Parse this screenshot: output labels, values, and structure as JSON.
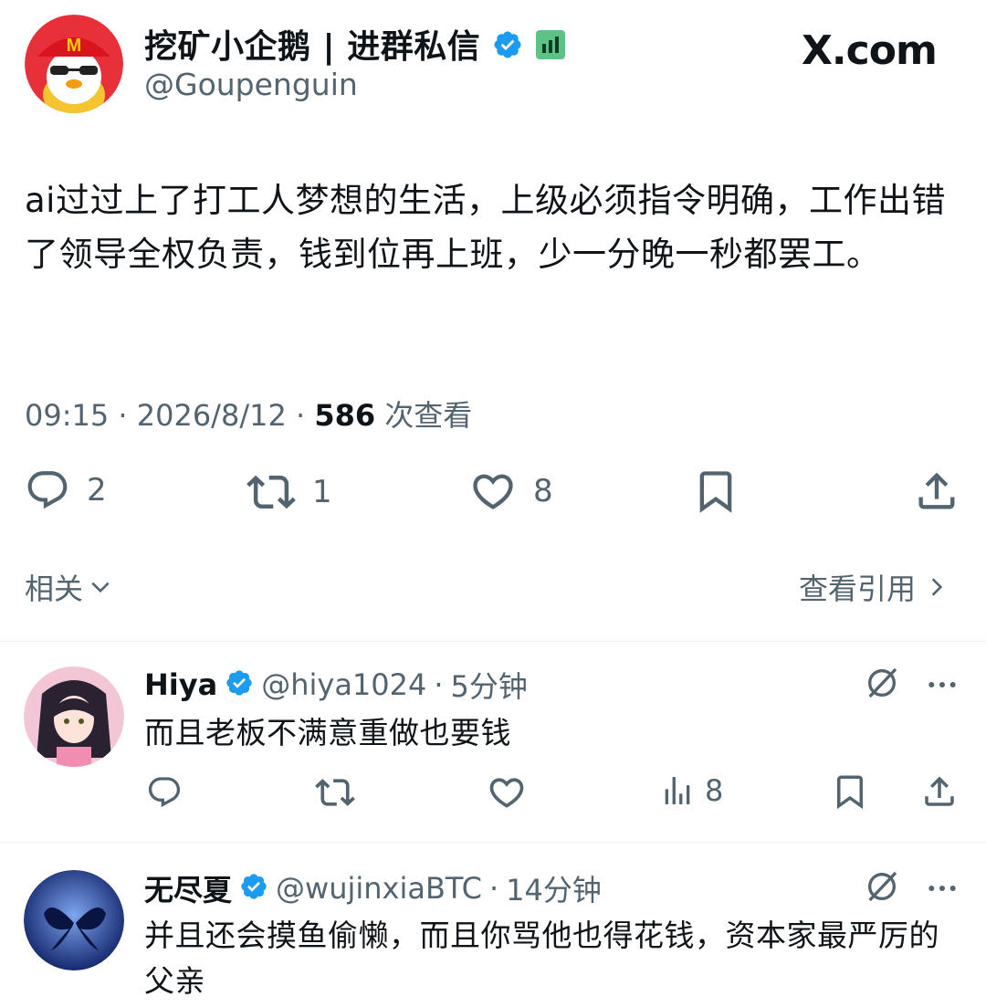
{
  "source": {
    "site": "X.com"
  },
  "tweet": {
    "display_name": "挖矿小企鹅 | 进群私信",
    "handle": "@Goupenguin",
    "text": "ai过过上了打工人梦想的生活，上级必须指令明确，工作出错了领导全权负责，钱到位再上班，少一分晚一秒都罢工。",
    "time": "09:15",
    "date": "2026/8/12",
    "views": "586",
    "views_label": "次查看",
    "replies": "2",
    "retweets": "1",
    "likes": "8"
  },
  "nav": {
    "related_label": "相关",
    "quotes_label": "查看引用"
  },
  "replies": [
    {
      "name": "Hiya",
      "handle": "@hiya1024",
      "time": "5分钟",
      "text": "而且老板不满意重做也要钱",
      "views": "8"
    },
    {
      "name": "无尽夏",
      "handle": "@wujinxiaBTC",
      "time": "14分钟",
      "text": "并且还会摸鱼偷懒，而且你骂他也得花钱，资本家最严厉的父亲"
    }
  ],
  "colors": {
    "verified": "#1d9bf0",
    "muted": "#536471",
    "text": "#0f1419"
  }
}
